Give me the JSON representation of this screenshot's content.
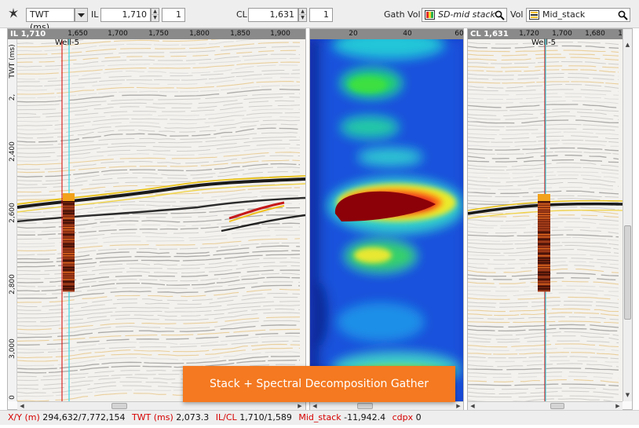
{
  "toolbar": {
    "domain_select": "TWT (ms)",
    "il_label": "IL",
    "il_value": "1,710",
    "il_step": "1",
    "cl_label": "CL",
    "cl_value": "1,631",
    "cl_step": "1",
    "gath_vol_label": "Gath Vol",
    "gath_vol_value": "SD-mid stack",
    "vol_label": "Vol",
    "vol_value": "Mid_stack"
  },
  "left_panel": {
    "title": "IL 1,710",
    "ticks": [
      "1,650",
      "1,700",
      "1,750",
      "1,800",
      "1,850",
      "1,900"
    ],
    "y_axis_label": "TWT (ms)",
    "y_ticks": [
      "2,400",
      "2,600",
      "2,800",
      "3,000",
      "0"
    ],
    "y_partial": "2,",
    "well": "Well-5"
  },
  "middle_panel": {
    "ticks": [
      "20",
      "40",
      "60"
    ]
  },
  "right_panel": {
    "title": "CL 1,631",
    "ticks": [
      "1,720",
      "1,700",
      "1,680",
      "1"
    ],
    "well": "Well-5"
  },
  "caption": "Stack + Spectral Decomposition Gather",
  "status": {
    "xy_key": "X/Y (m)",
    "xy_val": "294,632/7,772,154",
    "twt_key": "TWT (ms)",
    "twt_val": "2,073.3",
    "ilcl_key": "IL/CL",
    "ilcl_val": "1,710/1,589",
    "vol_key": "Mid_stack",
    "vol_val": "-11,942.4",
    "cdpx_key": "cdpx",
    "cdpx_val": "0"
  },
  "colors": {
    "well_red": "#d40000",
    "well_cyan": "#3ad7e6",
    "caption_orange": "#f47920",
    "status_red": "#d60000"
  }
}
